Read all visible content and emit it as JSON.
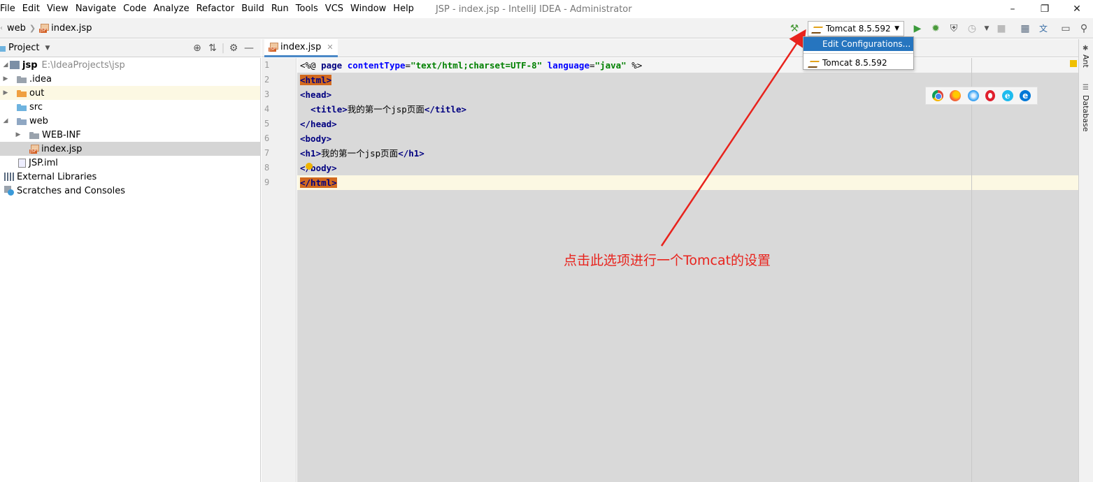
{
  "menu": {
    "items": [
      "File",
      "Edit",
      "View",
      "Navigate",
      "Code",
      "Analyze",
      "Refactor",
      "Build",
      "Run",
      "Tools",
      "VCS",
      "Window",
      "Help"
    ],
    "window_title": "JSP - index.jsp - IntelliJ IDEA - Administrator"
  },
  "navbar": {
    "crumb_folder": "web",
    "crumb_file": "index.jsp",
    "run_config": "Tomcat 8.5.592"
  },
  "run_dropdown": {
    "edit_configurations": "Edit Configurations...",
    "config_item": "Tomcat 8.5.592"
  },
  "project_panel": {
    "title": "Project",
    "tree": [
      {
        "label": "jsp",
        "hint": "E:\\IdeaProjects\\jsp"
      },
      {
        "label": ".idea"
      },
      {
        "label": "out"
      },
      {
        "label": "src"
      },
      {
        "label": "web"
      },
      {
        "label": "WEB-INF"
      },
      {
        "label": "index.jsp"
      },
      {
        "label": "JSP.iml"
      },
      {
        "label": "External Libraries"
      },
      {
        "label": "Scratches and Consoles"
      }
    ]
  },
  "editor": {
    "tab_label": "index.jsp",
    "line_numbers": [
      "1",
      "2",
      "3",
      "4",
      "5",
      "6",
      "7",
      "8",
      "9"
    ],
    "lines": {
      "l1": {
        "open": "<%@ ",
        "page": "page",
        "attr1": "contentType",
        "eq1": "=",
        "val1": "\"text/html;charset=UTF-8\"",
        "attr2": "language",
        "eq2": "=",
        "val2": "\"java\"",
        "close": " %>"
      },
      "l2": "<html>",
      "l3": "<head>",
      "l4": {
        "indent": "  ",
        "open_tag": "<title>",
        "text": "我的第一个jsp页面",
        "close_tag": "</title>"
      },
      "l5": "</head>",
      "l6": "<body>",
      "l7": {
        "open_tag": "<h1>",
        "text": "我的第一个jsp页面",
        "close_tag": "</h1>"
      },
      "l8": "</body>",
      "l9": "</html>"
    }
  },
  "right_bar": {
    "ant": "Ant",
    "database": "Database"
  },
  "annotation": {
    "text": "点击此选项进行一个Tomcat的设置",
    "color": "#e8231d"
  },
  "colors": {
    "selection": "#2675bf",
    "tag": "#000080",
    "string": "#008000",
    "highlight_tag_bg": "#d2691e"
  }
}
